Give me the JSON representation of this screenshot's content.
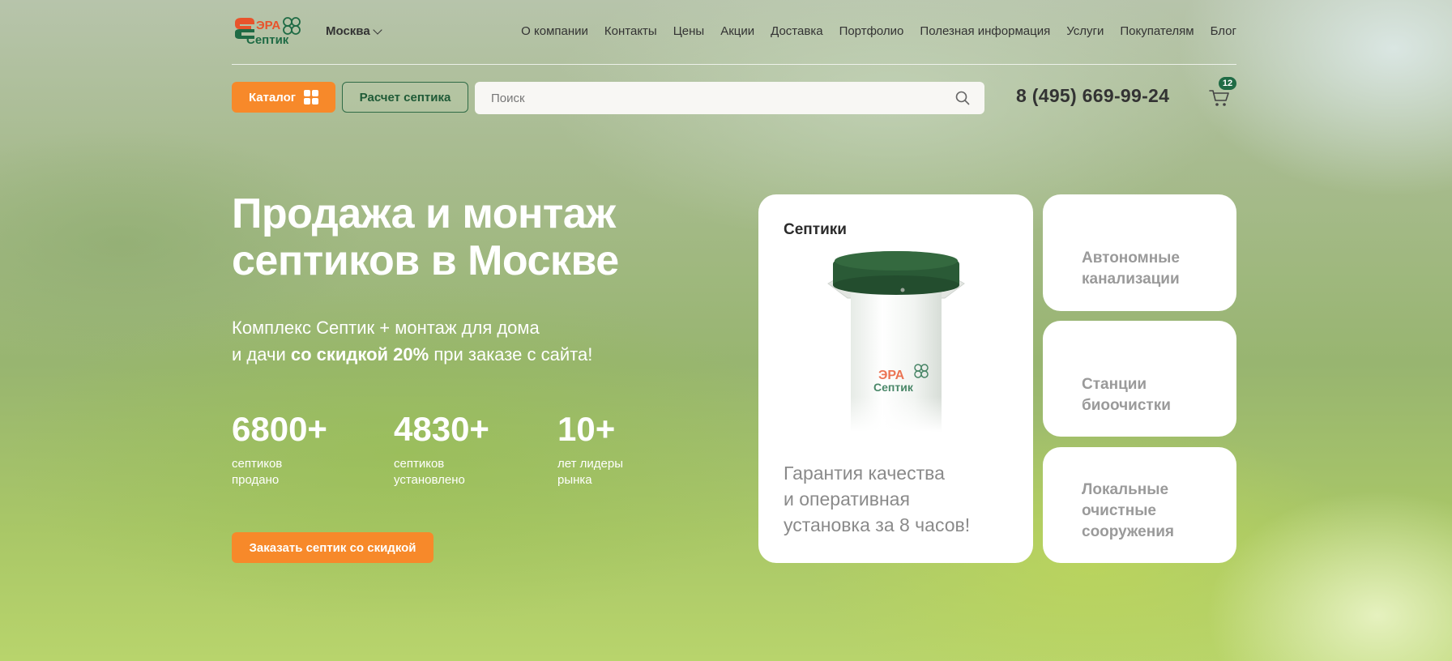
{
  "header": {
    "logo": {
      "line1": "ЭРА",
      "line2": "Септик"
    },
    "city": "Москва",
    "nav": [
      {
        "label": "О компании"
      },
      {
        "label": "Контакты"
      },
      {
        "label": "Цены"
      },
      {
        "label": "Акции"
      },
      {
        "label": "Доставка"
      },
      {
        "label": "Портфолио"
      },
      {
        "label": "Полезная информация"
      },
      {
        "label": "Услуги"
      },
      {
        "label": "Покупателям"
      },
      {
        "label": "Блог"
      }
    ]
  },
  "toolbar": {
    "catalog_label": "Каталог",
    "calc_label": "Расчет септика",
    "search_placeholder": "Поиск",
    "search_value": "",
    "phone": "8 (495) 669-99-24",
    "cart_count": "12"
  },
  "hero": {
    "title_line1": "Продажа и монтаж",
    "title_line2": "септиков в Москве",
    "sub_line1": "Комплекс Септик + монтаж для дома",
    "sub_line2_start": "и дачи ",
    "sub_line2_bold": "со скидкой 20%",
    "sub_line2_end": " при заказе с сайта!",
    "stats": [
      {
        "value": "6800+",
        "label1": "септиков",
        "label2": "продано"
      },
      {
        "value": "4830+",
        "label1": "септиков",
        "label2": "установлено"
      },
      {
        "value": "10+",
        "label1": "лет лидеры",
        "label2": "рынка"
      }
    ],
    "order_button": "Заказать септик со скидкой"
  },
  "cards": {
    "main": {
      "title": "Септики",
      "desc_line1": "Гарантия качества",
      "desc_line2": "и оперативная",
      "desc_line3": "установка за 8 часов!"
    },
    "side": [
      {
        "line1": "Автономные",
        "line2": "канализации",
        "line3": ""
      },
      {
        "line1": "Станции",
        "line2": "биоочистки",
        "line3": ""
      },
      {
        "line1": "Локальные",
        "line2": "очистные",
        "line3": "сооружения"
      }
    ]
  },
  "colors": {
    "accent_orange": "#f7892a",
    "brand_green": "#1f6b45",
    "logo_orange": "#e8532b"
  }
}
